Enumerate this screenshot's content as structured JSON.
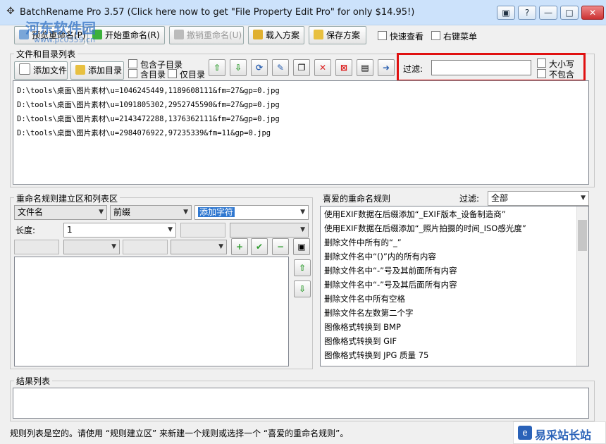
{
  "window": {
    "title": "BatchRename Pro 3.57 (Click here now to get \"File Property Edit Pro\" for only $14.95!)",
    "controls": [
      "▣",
      "?",
      "—",
      "□",
      "✕"
    ]
  },
  "toolbar": {
    "preview_label": "预览重命名(P)",
    "start_label": "开始重命名(R)",
    "undo_label": "撤销重命名(U)",
    "load_label": "载入方案",
    "save_label": "保存方案",
    "quick_view_label": "快速查看",
    "right_menu_label": "右键菜单"
  },
  "file_list": {
    "group_label": "文件和目录列表",
    "add_file_label": "添加文件",
    "add_dir_label": "添加目录",
    "include_sub_label": "包含子目录",
    "include_dir_label": "含目录",
    "only_dir_label": "仅目录",
    "filter_label": "过滤:",
    "filter_value": "",
    "case_label": "大小写",
    "not_contain_label": "不包含",
    "files": [
      "D:\\tools\\桌面\\图片素材\\u=1046245449,1189608111&fm=27&gp=0.jpg",
      "D:\\tools\\桌面\\图片素材\\u=1091805302,2952745590&fm=27&gp=0.jpg",
      "D:\\tools\\桌面\\图片素材\\u=2143472288,1376362111&fm=27&gp=0.jpg",
      "D:\\tools\\桌面\\图片素材\\u=2984076922,97235339&fm=11&gp=0.jpg"
    ]
  },
  "rule_builder": {
    "group_label": "重命名规则建立区和列表区",
    "field_select": "文件名",
    "position_select": "前缀",
    "action_input": "添加字符",
    "length_label": "长度:",
    "length_value": "1"
  },
  "favorites": {
    "label": "喜爱的重命名规则",
    "filter_label": "过滤:",
    "filter_value": "全部",
    "items": [
      "使用EXIF数据在后缀添加“_EXIF版本_设备制造商”",
      "使用EXIF数据在后缀添加“_照片拍摄的时间_ISO感光度”",
      "删除文件中所有的“_”",
      "删除文件名中“()”内的所有内容",
      "删除文件名中“-”号及其前面所有内容",
      "删除文件名中“-”号及其后面所有内容",
      "删除文件名中所有空格",
      "删除文件名左数第二个字",
      "图像格式转换到 BMP",
      "图像格式转换到 GIF",
      "图像格式转换到 JPG 质量 75"
    ]
  },
  "results": {
    "label": "结果列表"
  },
  "status": {
    "text": "规则列表是空的。请使用 “规则建立区” 来新建一个规则或选择一个 “喜爱的重命名规则”。"
  },
  "watermark": {
    "site_name": "河东软件园",
    "site_url": "www.pc0359.cn",
    "logo_text": "易采站长站"
  },
  "colors": {
    "highlight_border": "#e01010",
    "title_bg": "#cce2fb"
  }
}
